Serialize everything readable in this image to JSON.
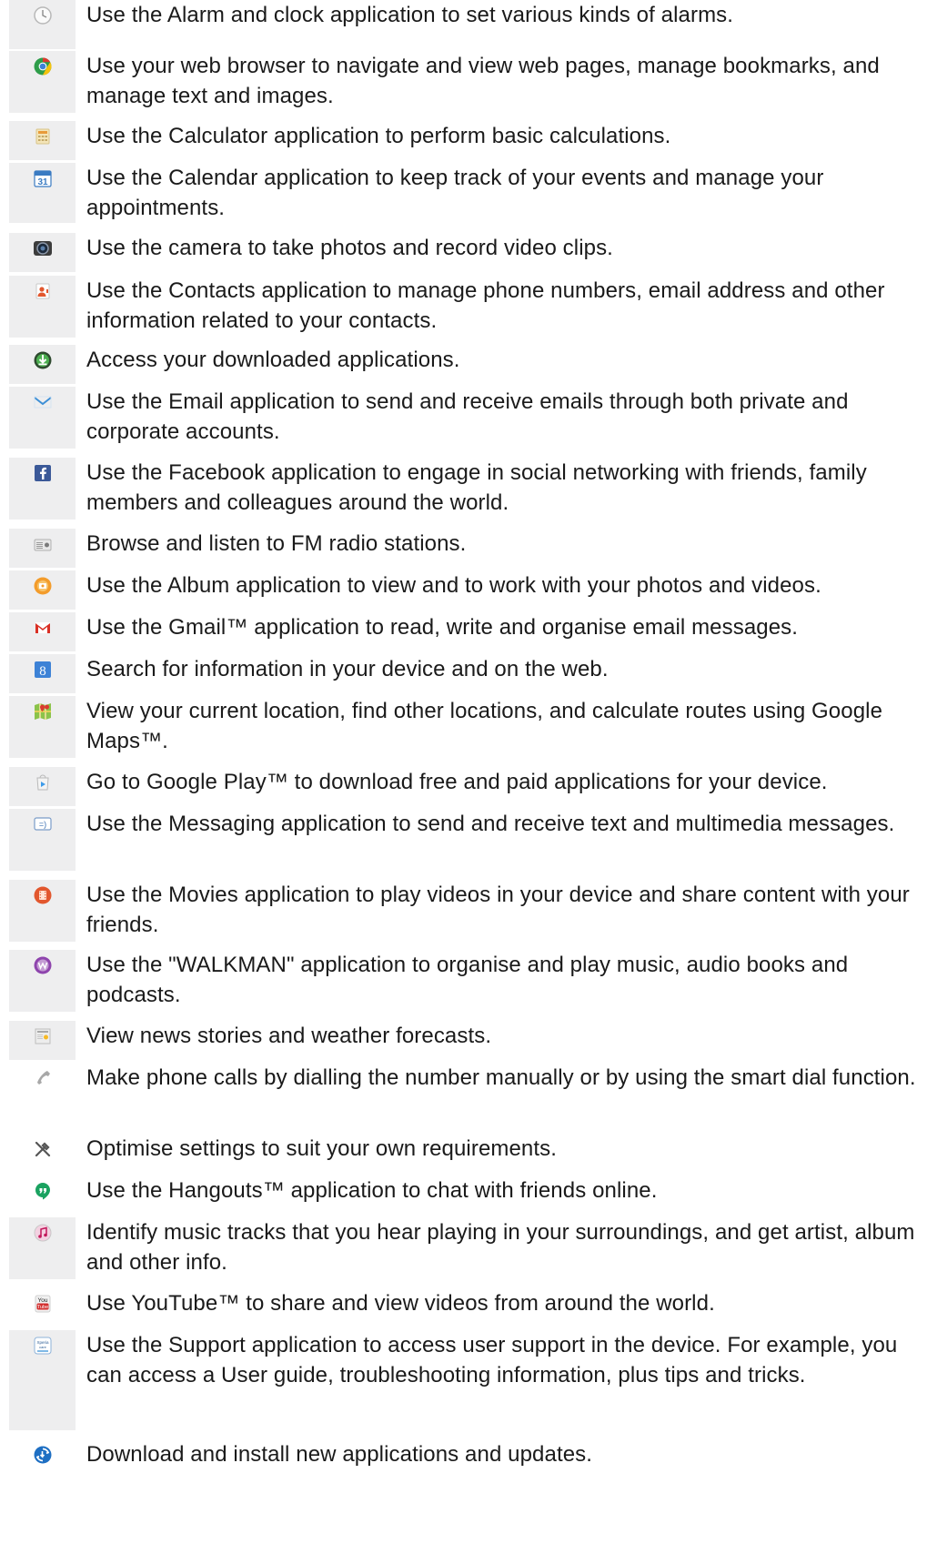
{
  "items": [
    {
      "icon": "alarm-clock-icon",
      "text": "Use the Alarm and clock application to set various kinds of alarms."
    },
    {
      "icon": "browser-icon",
      "text": "Use your web browser to navigate and view web pages, manage bookmarks, and manage text and images."
    },
    {
      "icon": "calculator-icon",
      "text": "Use the Calculator application to perform basic calculations."
    },
    {
      "icon": "calendar-icon",
      "text": "Use the Calendar application to keep track of your events and manage your appointments."
    },
    {
      "icon": "camera-icon",
      "text": "Use the camera to take photos and record video clips."
    },
    {
      "icon": "contacts-icon",
      "text": "Use the Contacts application to manage phone numbers, email address and other information related to your contacts."
    },
    {
      "icon": "download-icon",
      "text": "Access your downloaded applications."
    },
    {
      "icon": "email-icon",
      "text": "Use the Email application to send and receive emails through both private and corporate accounts."
    },
    {
      "icon": "facebook-icon",
      "text": "Use the Facebook application to engage in social networking with friends, family members and colleagues around the world."
    },
    {
      "icon": "fm-radio-icon",
      "text": "Browse and listen to FM radio stations."
    },
    {
      "icon": "album-icon",
      "text": "Use the Album application to view and to work with your photos and videos."
    },
    {
      "icon": "gmail-icon",
      "text": "Use the Gmail™ application to read, write and organise email messages."
    },
    {
      "icon": "google-search-icon",
      "text": "Search for information in your device and on the web."
    },
    {
      "icon": "maps-icon",
      "text": "View your current location, find other locations, and calculate routes using Google Maps™."
    },
    {
      "icon": "play-store-icon",
      "text": "Go to Google Play™ to download free and paid applications for your device."
    },
    {
      "icon": "messaging-icon",
      "text": "Use the Messaging application to send and receive text and multimedia messages."
    },
    {
      "icon": "movies-icon",
      "text": "Use the Movies application to play videos in your device and share content with your friends."
    },
    {
      "icon": "walkman-icon",
      "text": "Use the \"WALKMAN\" application to organise and play music, audio books and podcasts."
    },
    {
      "icon": "news-weather-icon",
      "text": "View news stories and weather forecasts."
    },
    {
      "icon": "phone-icon",
      "text": "Make phone calls by dialling the number manually or by using the smart dial function."
    },
    {
      "icon": "settings-icon",
      "text": "Optimise settings to suit your own requirements."
    },
    {
      "icon": "hangouts-icon",
      "text": "Use the Hangouts™ application to chat with friends online."
    },
    {
      "icon": "trackid-icon",
      "text": "Identify music tracks that you hear playing in your surroundings, and get artist, album and other info."
    },
    {
      "icon": "youtube-icon",
      "text": "Use YouTube™ to share and view videos from around the world."
    },
    {
      "icon": "support-icon",
      "text": "Use the Support application to access user support in the device. For example, you can access a User guide, troubleshooting information, plus tips and tricks."
    },
    {
      "icon": "update-center-icon",
      "text": "Download and install new applications and updates."
    }
  ],
  "icon_labels": {
    "calendar": "31",
    "youtube_top": "You",
    "youtube_bottom": "Tube",
    "support": "Xperia care"
  },
  "colors": {
    "icon_cell_bg": "#eeeeef",
    "text": "#1a1a1a",
    "facebook_blue": "#3b5998",
    "gmail_red": "#d93025",
    "google_blue": "#3d82d6",
    "download_green": "#2e7d32"
  }
}
